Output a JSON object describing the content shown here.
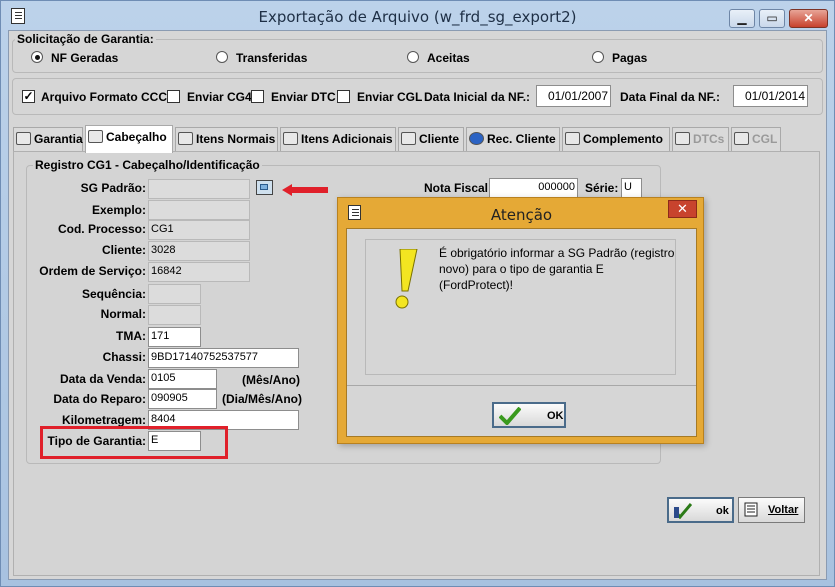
{
  "window": {
    "title": "Exportação de Arquivo (w_frd_sg_export2)",
    "minimize": "▁",
    "maximize": "▭",
    "close": "✕"
  },
  "solicitacao": {
    "label": "Solicitação de Garantia:",
    "options": [
      "NF Geradas",
      "Transferidas",
      "Aceitas",
      "Pagas"
    ],
    "selected": "NF Geradas"
  },
  "options_bar": {
    "arquivo_formato_ccc": "Arquivo Formato CCC",
    "arquivo_formato_ccc_checked": true,
    "enviar_cg4": "Enviar CG4",
    "enviar_dtc": "Enviar DTC",
    "enviar_cgl": "Enviar CGL",
    "data_inicial_label": "Data Inicial da NF.:",
    "data_inicial_value": "01/01/2007",
    "data_final_label": "Data Final da NF.:",
    "data_final_value": "01/01/2014"
  },
  "tabs": [
    "Garantia",
    "Cabeçalho",
    "Itens Normais",
    "Itens Adicionais",
    "Cliente",
    "Rec. Cliente",
    "Complemento",
    "DTCs",
    "CGL"
  ],
  "active_tab": "Cabeçalho",
  "registro": {
    "group_title": "Registro CG1 - Cabeçalho/Identificação",
    "sg_padrao_label": "SG Padrão:",
    "sg_padrao_value": "",
    "exemplo_label": "Exemplo:",
    "exemplo_value": "",
    "cod_processo_label": "Cod. Processo:",
    "cod_processo_value": "CG1",
    "cliente_label": "Cliente:",
    "cliente_value": "3028",
    "ordem_servico_label": "Ordem de Serviço:",
    "ordem_servico_value": "16842",
    "sequencia_label": "Sequência:",
    "sequencia_value": "",
    "normal_label": "Normal:",
    "normal_value": "",
    "tma_label": "TMA:",
    "tma_value": "171",
    "chassi_label": "Chassi:",
    "chassi_value": "9BD17140752537577",
    "data_venda_label": "Data da Venda:",
    "data_venda_value": "0105",
    "data_venda_hint": "(Mês/Ano)",
    "data_reparo_label": "Data do Reparo:",
    "data_reparo_value": "090905",
    "data_reparo_hint": "(Dia/Mês/Ano)",
    "kilometragem_label": "Kilometragem:",
    "kilometragem_value": "8404",
    "tipo_garantia_label": "Tipo de Garantia:",
    "tipo_garantia_value": "E",
    "nota_fiscal_label": "Nota Fiscal:",
    "nota_fiscal_value": "000000",
    "serie_label": "Série:",
    "serie_value": "U"
  },
  "dialog": {
    "title": "Atenção",
    "message": "É obrigatório informar a SG Padrão (registro novo) para o tipo de garantia E (FordProtect)!",
    "ok_label": "OK",
    "close": "✕"
  },
  "footer_buttons": {
    "ok_label": "ok",
    "voltar_label": "Voltar"
  },
  "colors": {
    "dialog_frame": "#e5a936",
    "highlight_red": "#e0202a",
    "window_frame": "#a9c4e3"
  }
}
